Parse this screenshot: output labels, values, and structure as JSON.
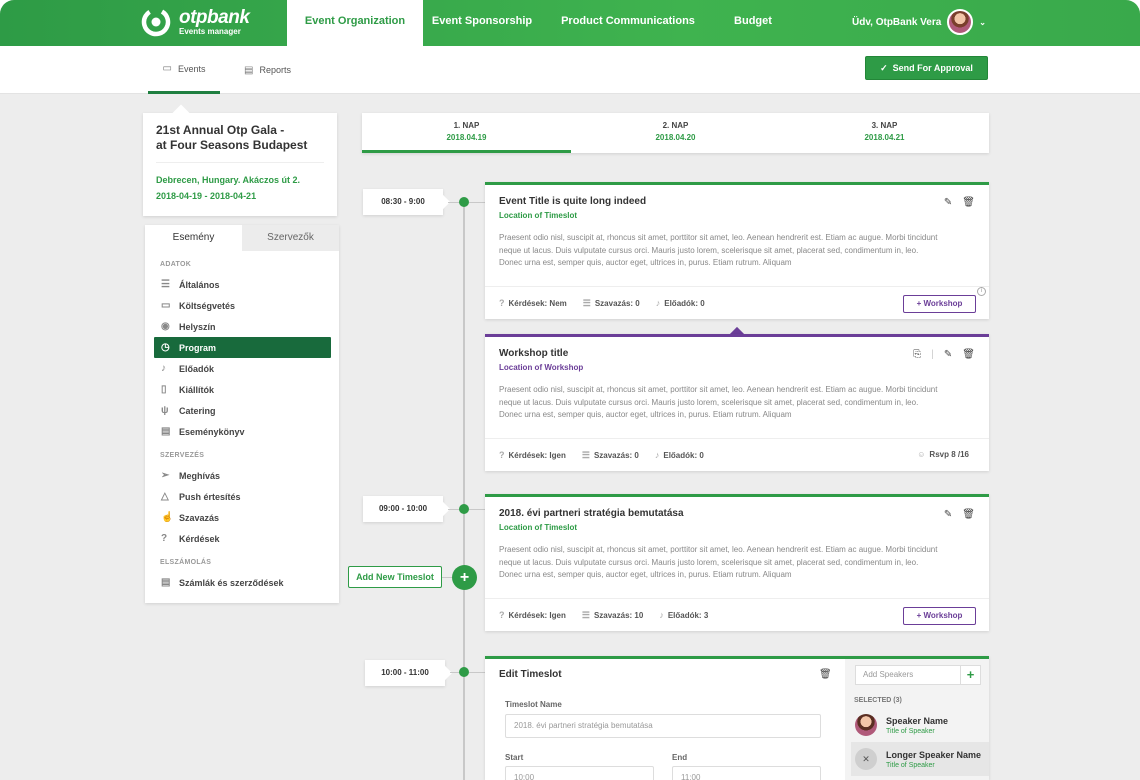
{
  "brand": {
    "name": "otpbank",
    "subtitle": "Events manager"
  },
  "nav": {
    "tabs": [
      {
        "label": "Event Organization",
        "active": true
      },
      {
        "label": "Event Sponsorship",
        "active": false
      },
      {
        "label": "Product Communications",
        "active": false
      },
      {
        "label": "Budget",
        "active": false
      }
    ],
    "user_greeting": "Üdv, OtpBank Vera"
  },
  "subnav": {
    "tabs": [
      {
        "label": "Events",
        "icon": "calendar-icon",
        "active": true
      },
      {
        "label": "Reports",
        "icon": "document-icon",
        "active": false
      }
    ],
    "approve_label": "Send For Approval"
  },
  "event": {
    "title_line1": "21st Annual Otp Gala -",
    "title_line2": "at Four Seasons Budapest",
    "location": "Debrecen, Hungary. Akáczos út 2.",
    "dates": "2018-04-19 - 2018-04-21"
  },
  "sidebar": {
    "tabs": [
      {
        "label": "Esemény",
        "active": true
      },
      {
        "label": "Szervezők",
        "active": false
      }
    ],
    "sections": [
      {
        "title": "ADATOK",
        "items": [
          {
            "label": "Általános",
            "icon": "list-icon"
          },
          {
            "label": "Költségvetés",
            "icon": "wallet-icon"
          },
          {
            "label": "Helyszín",
            "icon": "location-pin-icon"
          },
          {
            "label": "Program",
            "icon": "clock-icon",
            "active": true
          },
          {
            "label": "Előadók",
            "icon": "microphone-icon"
          },
          {
            "label": "Kiállítók",
            "icon": "bottle-icon"
          },
          {
            "label": "Catering",
            "icon": "cutlery-icon"
          },
          {
            "label": "Eseménykönyv",
            "icon": "book-icon"
          }
        ]
      },
      {
        "title": "SZERVEZÉS",
        "items": [
          {
            "label": "Meghívás",
            "icon": "paper-plane-icon"
          },
          {
            "label": "Push értesítés",
            "icon": "bell-icon"
          },
          {
            "label": "Szavazás",
            "icon": "thumbs-up-icon"
          },
          {
            "label": "Kérdések",
            "icon": "question-icon"
          }
        ]
      },
      {
        "title": "ELSZÁMOLÁS",
        "items": [
          {
            "label": "Számlák és szerződések",
            "icon": "invoice-icon"
          }
        ]
      }
    ]
  },
  "days": [
    {
      "label": "1. NAP",
      "date": "2018.04.19",
      "active": true
    },
    {
      "label": "2. NAP",
      "date": "2018.04.20",
      "active": false
    },
    {
      "label": "3. NAP",
      "date": "2018.04.21",
      "active": false
    }
  ],
  "timeslots": [
    {
      "time": "08:30 - 9:00"
    },
    {
      "time": "09:00 - 10:00"
    },
    {
      "time": "10:00 - 11:00"
    }
  ],
  "add_timeslot_label": "Add New Timeslot",
  "cards": [
    {
      "title": "Event Title is quite long indeed",
      "location": "Location of Timeslot",
      "desc": "Praesent odio nisl, suscipit at, rhoncus sit amet, porttitor sit amet, leo. Aenean hendrerit est. Etiam ac augue. Morbi tincidunt neque ut lacus. Duis vulputate cursus orci. Mauris justo lorem, scelerisque sit amet, placerat sed, condimentum in, leo. Donec urna est, semper quis, auctor eget, ultrices in, purus. Etiam rutrum. Aliquam",
      "questions": "Kérdések: Nem",
      "votes": "Szavazás: 0",
      "speakers": "Előadók: 0",
      "workshop_label": "+ Workshop"
    },
    {
      "title": "Workshop title",
      "location": "Location of Workshop",
      "desc": "Praesent odio nisl, suscipit at, rhoncus sit amet, porttitor sit amet, leo. Aenean hendrerit est. Etiam ac augue. Morbi tincidunt neque ut lacus. Duis vulputate cursus orci. Mauris justo lorem, scelerisque sit amet, placerat sed, condimentum in, leo. Donec urna est, semper quis, auctor eget, ultrices in, purus. Etiam rutrum. Aliquam",
      "questions": "Kérdések: Igen",
      "votes": "Szavazás: 0",
      "speakers": "Előadók: 0",
      "rsvp": "Rsvp 8 /16"
    },
    {
      "title": "2018. évi partneri stratégia bemutatása",
      "location": "Location of Timeslot",
      "desc": "Praesent odio nisl, suscipit at, rhoncus sit amet, porttitor sit amet, leo. Aenean hendrerit est. Etiam ac augue. Morbi tincidunt neque ut lacus. Duis vulputate cursus orci. Mauris justo lorem, scelerisque sit amet, placerat sed, condimentum in, leo. Donec urna est, semper quis, auctor eget, ultrices in, purus. Etiam rutrum. Aliquam",
      "questions": "Kérdések: Igen",
      "votes": "Szavazás: 10",
      "speakers": "Előadók: 3",
      "workshop_label": "+ Workshop"
    }
  ],
  "edit": {
    "title": "Edit Timeslot",
    "name_label": "Timeslot Name",
    "name_value": "2018. évi partneri stratégia bemutatása",
    "start_label": "Start",
    "start_value": "10:00",
    "end_label": "End",
    "end_value": "11:00",
    "speakers_placeholder": "Add Speakers",
    "selected_label": "SELECTED (3)",
    "speakers": [
      {
        "name": "Speaker Name",
        "title": "Title of Speaker"
      },
      {
        "name": "Longer Speaker Name",
        "title": "Title of Speaker"
      }
    ]
  },
  "colors": {
    "brand_green": "#2e9b46",
    "dark_green": "#186a3c",
    "workshop_purple": "#6b3e98"
  }
}
